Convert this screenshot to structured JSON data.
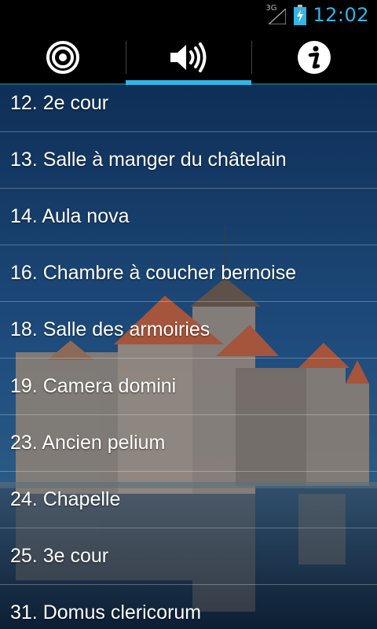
{
  "status_bar": {
    "network": "3G",
    "time": "12:02",
    "icons": [
      "signal-icon",
      "battery-icon"
    ],
    "accent": "#33b5e5"
  },
  "tabs": [
    {
      "icon": "target-icon",
      "active": false
    },
    {
      "icon": "speaker-icon",
      "active": true
    },
    {
      "icon": "info-icon",
      "active": false
    }
  ],
  "list": {
    "items": [
      {
        "label": "12. 2e cour"
      },
      {
        "label": "13. Salle à manger du châtelain"
      },
      {
        "label": "14. Aula nova"
      },
      {
        "label": "16. Chambre à coucher bernoise"
      },
      {
        "label": "18. Salle des armoiries"
      },
      {
        "label": "19. Camera domini"
      },
      {
        "label": "23. Ancien pelium"
      },
      {
        "label": "24. Chapelle"
      },
      {
        "label": "25. 3e cour"
      },
      {
        "label": "31. Domus clericorum"
      }
    ]
  }
}
